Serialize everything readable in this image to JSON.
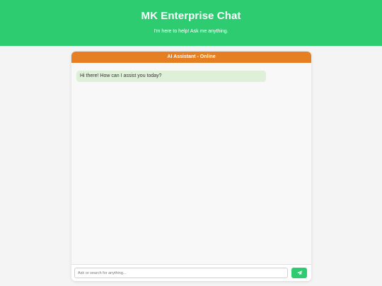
{
  "header": {
    "title": "MK Enterprise Chat",
    "subtitle": "I'm here to help! Ask me anything."
  },
  "chat": {
    "header_title": "AI Assistant - Online",
    "messages": [
      {
        "sender": "bot",
        "text": "Hi there! How can I assist you today?"
      }
    ]
  },
  "input": {
    "placeholder": "Ask or search for anything...",
    "value": ""
  },
  "send_button": {
    "icon": "paper-plane-icon"
  },
  "colors": {
    "header_bg": "#2ecc71",
    "chat_header_bg": "#e67e22",
    "bot_bubble_bg": "#dff0d8",
    "send_button_bg": "#2ecc71",
    "page_bg": "#f4f4f4"
  }
}
